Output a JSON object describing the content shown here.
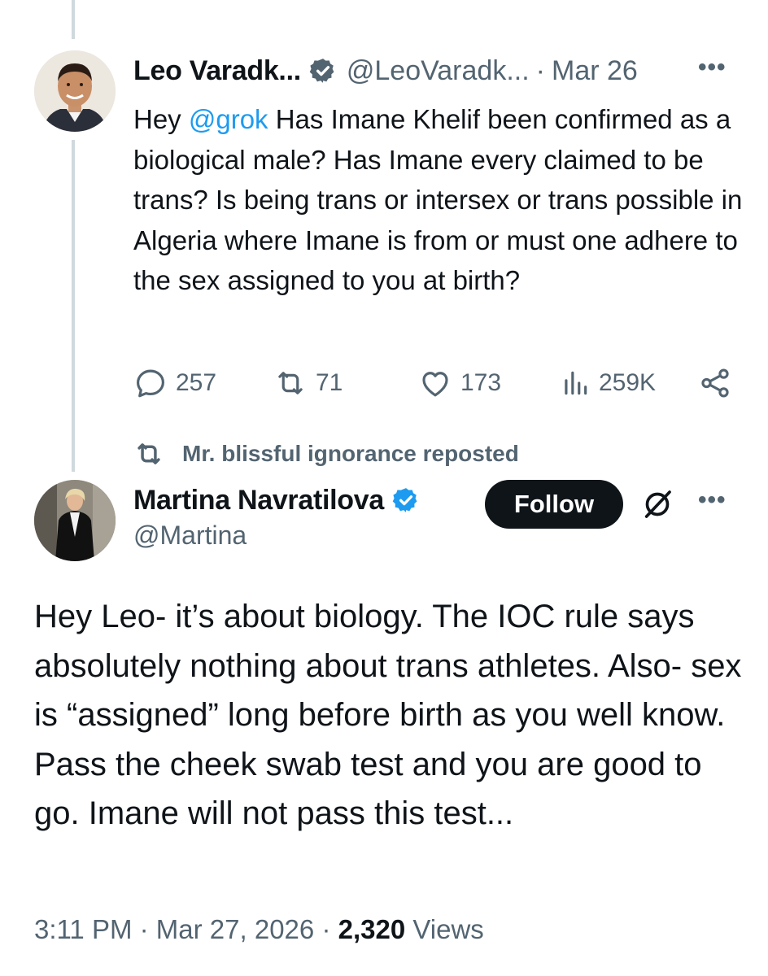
{
  "quoted_post": {
    "author_name": "Leo Varadk...",
    "handle": "@LeoVaradk...",
    "separator": "·",
    "date": "Mar 26",
    "more_label": "•••",
    "text_before_mention": "Hey ",
    "mention": "@grok",
    "text_after_mention": " Has Imane Khelif been confirmed as a biological male?  Has Imane every claimed to be trans?  Is being trans or intersex or trans possible in Algeria where Imane is from or must one adhere to the sex assigned to you at birth?",
    "stats": {
      "replies": "257",
      "reposts": "71",
      "likes": "173",
      "views": "259K"
    },
    "icons": [
      "reply-icon",
      "retweet-icon",
      "heart-icon",
      "views-icon",
      "share-icon"
    ]
  },
  "repost_banner": {
    "text": "Mr. blissful ignorance reposted",
    "icon": "retweet-icon"
  },
  "main_post": {
    "author_name": "Martina Navratilova",
    "handle": "@Martina",
    "follow_label": "Follow",
    "more_label": "•••",
    "body": "Hey Leo- it’s about biology. The IOC rule says absolutely nothing about trans athletes. Also- sex is “assigned” long before birth as you well know. Pass the cheek swab test and you are good to go. Imane will not pass this test...",
    "time": "3:11 PM",
    "separator": "·",
    "date": "Mar 27, 2026",
    "views_count": "2,320",
    "views_label": "Views"
  },
  "colors": {
    "text": "#0f1419",
    "secondary": "#536471",
    "link": "#1d9bf0",
    "verified": "#1d9bf0",
    "thread_line": "#cfd9de",
    "follow_bg": "#0f1419"
  }
}
